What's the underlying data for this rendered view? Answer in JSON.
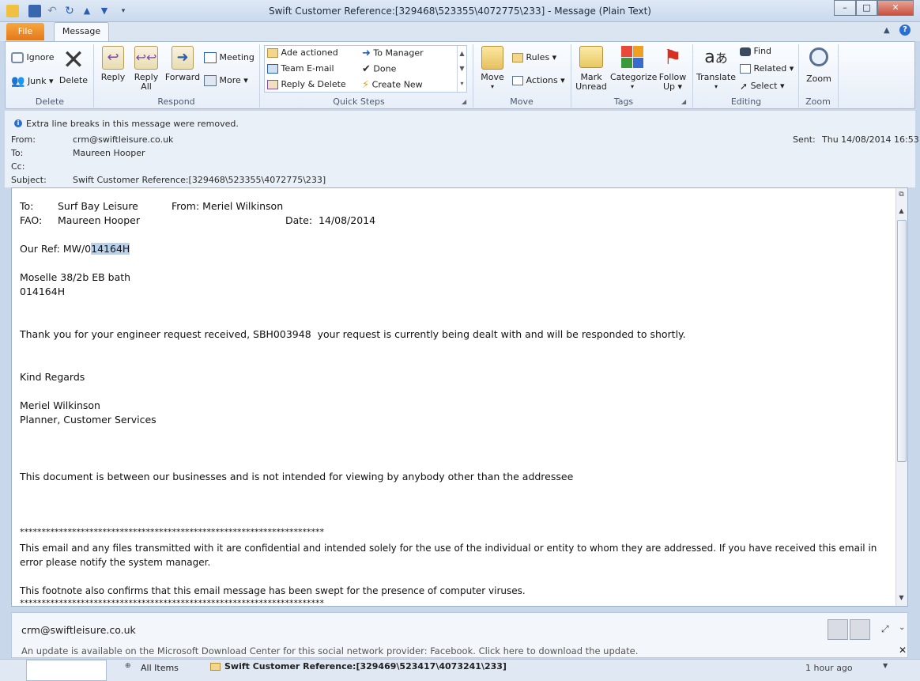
{
  "window": {
    "title": "Swift Customer Reference:[329468\\523355\\4072775\\233]  -  Message (Plain Text)",
    "minimize": "–",
    "maximize": "□",
    "close": "✕"
  },
  "tabs": {
    "file": "File",
    "message": "Message"
  },
  "ribbon": {
    "delete_group": {
      "label": "Delete",
      "ignore": "Ignore",
      "junk": "Junk",
      "delete": "Delete"
    },
    "respond_group": {
      "label": "Respond",
      "reply": "Reply",
      "reply_all_1": "Reply",
      "reply_all_2": "All",
      "forward": "Forward",
      "meeting": "Meeting",
      "more": "More"
    },
    "quick_steps": {
      "label": "Quick Steps",
      "items": [
        "Ade actioned",
        "Team E-mail",
        "Reply & Delete",
        "To Manager",
        "Done",
        "Create New"
      ]
    },
    "move_group": {
      "label": "Move",
      "move": "Move",
      "rules": "Rules",
      "actions": "Actions"
    },
    "tags_group": {
      "label": "Tags",
      "mark_1": "Mark",
      "mark_2": "Unread",
      "categorize": "Categorize",
      "follow_1": "Follow",
      "follow_2": "Up"
    },
    "editing_group": {
      "label": "Editing",
      "translate": "Translate",
      "find": "Find",
      "related": "Related",
      "select": "Select"
    },
    "zoom_group": {
      "label": "Zoom",
      "zoom": "Zoom"
    }
  },
  "header": {
    "info": "Extra line breaks in this message were removed.",
    "from_label": "From:",
    "from": "crm@swiftleisure.co.uk",
    "to_label": "To:",
    "to": "Maureen Hooper",
    "cc_label": "Cc:",
    "subject_label": "Subject:",
    "subject": "Swift Customer Reference:[329468\\523355\\4072775\\233]",
    "sent_label": "Sent:",
    "sent": "Thu 14/08/2014 16:53"
  },
  "body": {
    "l1a": "To:",
    "l1b": "Surf Bay Leisure",
    "l1c": "From: Meriel Wilkinson",
    "l2a": "FAO:",
    "l2b": "Maureen Hooper",
    "l2c": "Date:  14/08/2014",
    "ref_pre": "Our Ref: MW/0",
    "ref_sel": "14164H",
    "model": "Moselle 38/2b EB bath",
    "model_code": "014164H",
    "thanks": "Thank you for your engineer request received, SBH003948  your request is currently being dealt with and will be responded to shortly.",
    "regards": "Kind Regards",
    "name": "Meriel Wilkinson",
    "role": "Planner, Customer Services",
    "notice": "This document is between our businesses and is not intended for viewing by anybody other than the addressee",
    "stars": "**********************************************************************",
    "conf1": "This email and any files transmitted with it are confidential and intended solely for the use of the individual or entity to whom they are addressed. If you have received this email in",
    "conf2": "error please notify the system manager.",
    "footnote": "This footnote also confirms that this email message has been swept for the presence of computer viruses.",
    "stars2": "**********************************************************************"
  },
  "people_pane": {
    "sender": "crm@swiftleisure.co.uk",
    "update": "An update is available on the Microsoft Download Center for this social network provider: Facebook. Click here to download the update."
  },
  "status_bar": {
    "all_items": "All Items",
    "item_subject": "Swift Customer Reference:[329469\\523417\\4073241\\233]",
    "time": "1 hour ago"
  },
  "colors": {
    "file_tab": "#e4771b",
    "selection": "#b8d2ee",
    "accent": "#2a579a"
  }
}
